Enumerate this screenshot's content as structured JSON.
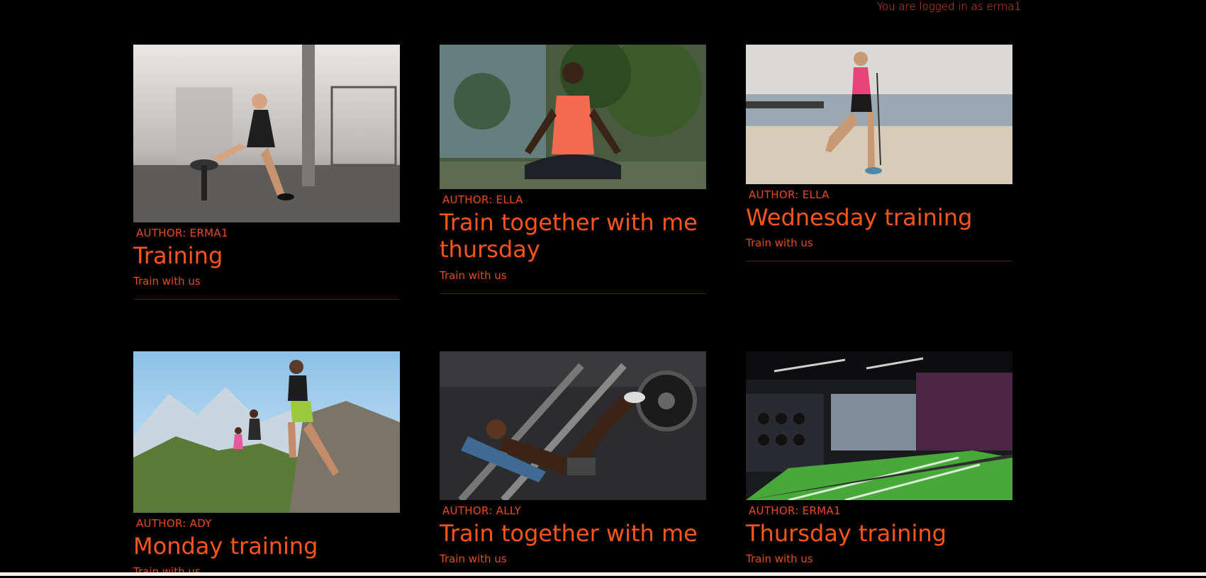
{
  "header": {
    "login_text": "You are logged in as erma1"
  },
  "posts": [
    {
      "author": "AUTHOR: ERMA1",
      "title": "Training",
      "subtitle": "Train with us",
      "image": "gym-lunge-photo"
    },
    {
      "author": "AUTHOR: ELLA",
      "title": "Train together with me thursday",
      "subtitle": "Train with us",
      "image": "meditation-photo"
    },
    {
      "author": "AUTHOR: ELLA",
      "title": "Wednesday training",
      "subtitle": "Train with us",
      "image": "beach-lunge-photo"
    },
    {
      "author": "AUTHOR: ADY",
      "title": "Monday training",
      "subtitle": "Train with us",
      "image": "mountain-run-photo"
    },
    {
      "author": "AUTHOR: ALLY",
      "title": "Train together with me",
      "subtitle": "Train with us",
      "image": "leg-press-photo"
    },
    {
      "author": "AUTHOR: ERMA1",
      "title": "Thursday training",
      "subtitle": "Train with us",
      "image": "gym-interior-photo"
    }
  ]
}
